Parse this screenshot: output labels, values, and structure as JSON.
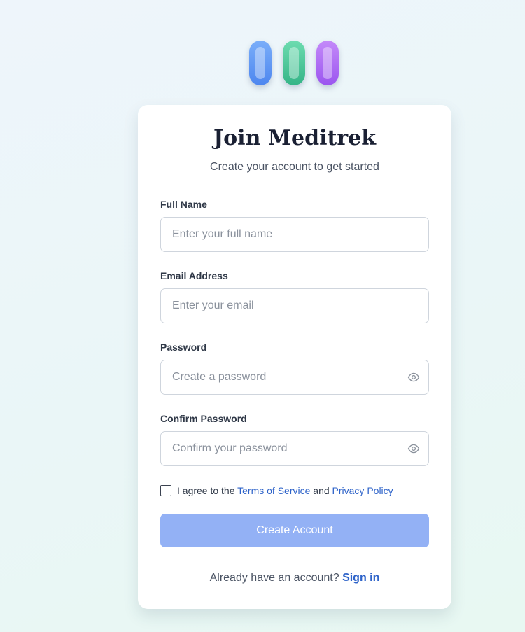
{
  "logo": {
    "pill_colors": [
      "#5b93f3",
      "#45c497",
      "#ad6cf3"
    ]
  },
  "card": {
    "title": "Join Meditrek",
    "subtitle": "Create your account to get started"
  },
  "form": {
    "full_name": {
      "label": "Full Name",
      "placeholder": "Enter your full name",
      "value": ""
    },
    "email": {
      "label": "Email Address",
      "placeholder": "Enter your email",
      "value": ""
    },
    "password": {
      "label": "Password",
      "placeholder": "Create a password",
      "value": "",
      "toggle_icon": "eye-icon"
    },
    "confirm_password": {
      "label": "Confirm Password",
      "placeholder": "Confirm your password",
      "value": "",
      "toggle_icon": "eye-icon"
    },
    "agree": {
      "checked": false,
      "prefix": "I agree to the ",
      "terms_link": "Terms of Service",
      "middle": " and ",
      "privacy_link": "Privacy Policy"
    },
    "submit_label": "Create Account"
  },
  "footer": {
    "prompt": "Already have an account? ",
    "signin_link": "Sign in"
  },
  "colors": {
    "accent": "#2e63c9",
    "submit_disabled": "#93b1f5",
    "title": "#1a2033"
  }
}
